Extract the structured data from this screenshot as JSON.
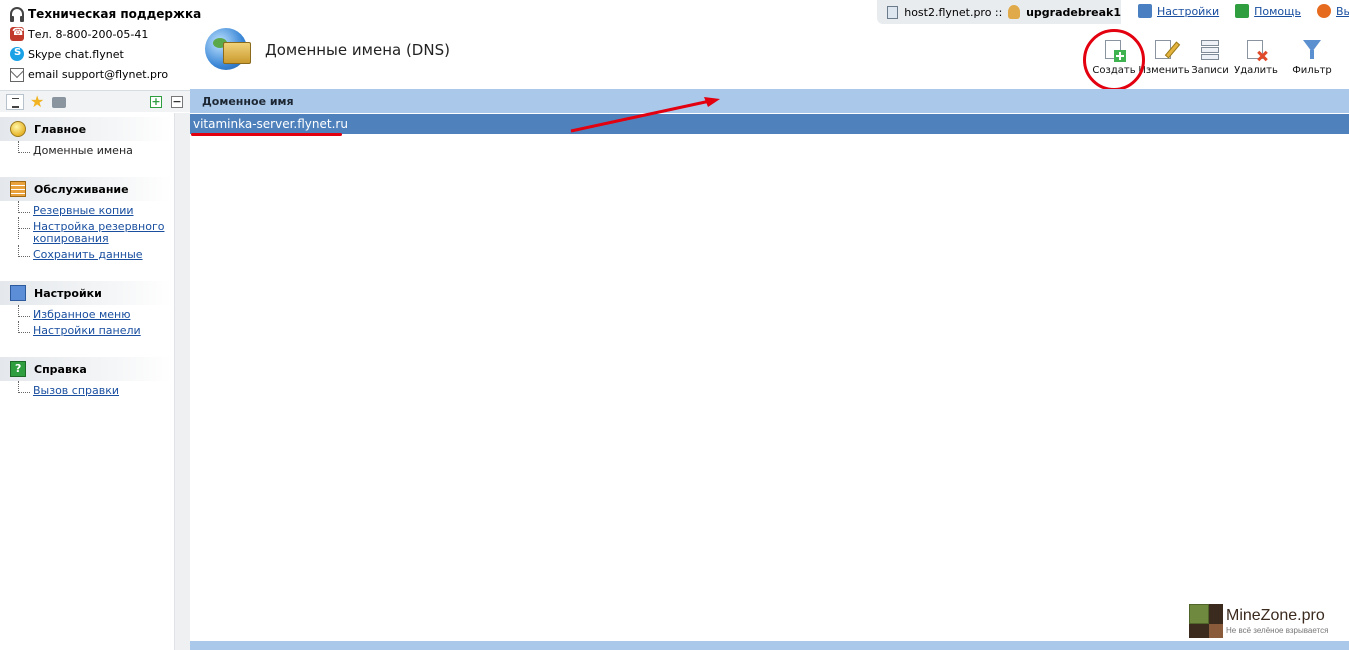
{
  "support": {
    "title": "Техническая поддержка",
    "phone": "Тел. 8-800-200-05-41",
    "skype": "Skype chat.flynet",
    "email": "email support@flynet.pro"
  },
  "header": {
    "host": "host2.flynet.pro ::",
    "username": "upgradebreak1",
    "links": {
      "settings": "Настройки",
      "help": "Помощь",
      "exit": "Выйт"
    }
  },
  "page": {
    "title": "Доменные имена (DNS)"
  },
  "toolbar": {
    "create": "Создать",
    "edit": "Изменить",
    "records": "Записи",
    "delete": "Удалить",
    "filter": "Фильтр"
  },
  "sidebar": {
    "groups": [
      {
        "title": "Главное",
        "icon": "home-icon",
        "items": [
          {
            "label": "Доменные имена",
            "link": false
          }
        ]
      },
      {
        "title": "Обслуживание",
        "icon": "maintenance-icon",
        "items": [
          {
            "label": "Резервные копии",
            "link": true
          },
          {
            "label": "Настройка резервного копирования",
            "link": true
          },
          {
            "label": "Сохранить данные",
            "link": true
          }
        ]
      },
      {
        "title": "Настройки",
        "icon": "settings-icon",
        "items": [
          {
            "label": "Избранное меню",
            "link": true
          },
          {
            "label": "Настройки панели",
            "link": true
          }
        ]
      },
      {
        "title": "Справка",
        "icon": "help-icon",
        "items": [
          {
            "label": "Вызов справки",
            "link": true
          }
        ]
      }
    ]
  },
  "table": {
    "columns": [
      "Доменное имя"
    ],
    "rows": [
      {
        "domain": "vitaminka-server.flynet.ru",
        "selected": true
      }
    ]
  },
  "watermark": {
    "brand": "MineZone.pro",
    "tagline": "Не всё зелёное взрывается"
  },
  "colors": {
    "header_blue": "#a9c8ea",
    "selection_blue": "#4f82bd",
    "annotation_red": "#e3000f",
    "link_blue": "#1a4fa0"
  }
}
